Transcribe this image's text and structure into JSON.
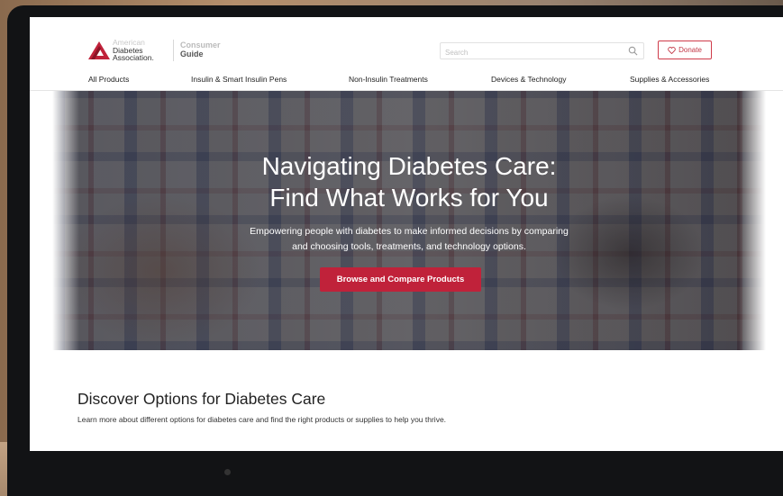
{
  "header": {
    "logo_lines": [
      "American",
      "Diabetes",
      "Association."
    ],
    "guide_lines": [
      "Consumer",
      "Guide"
    ],
    "search_placeholder": "Search",
    "donate_label": "Donate"
  },
  "nav": {
    "items": [
      {
        "label": "All Products"
      },
      {
        "label": "Insulin & Smart Insulin Pens"
      },
      {
        "label": "Non-Insulin Treatments"
      },
      {
        "label": "Devices & Technology"
      },
      {
        "label": "Supplies & Accessories"
      }
    ]
  },
  "hero": {
    "title_line1": "Navigating Diabetes Care:",
    "title_line2": "Find What Works for You",
    "subtitle_line1": "Empowering people with diabetes to make informed decisions by comparing",
    "subtitle_line2": "and choosing tools, treatments, and technology options.",
    "button_label": "Browse and Compare Products"
  },
  "discover": {
    "title": "Discover Options for Diabetes Care",
    "description": "Learn more about different options for diabetes care and find the right products or supplies to help you thrive."
  },
  "colors": {
    "brand_red": "#c0223a",
    "donate_red": "#cf3b4a"
  }
}
